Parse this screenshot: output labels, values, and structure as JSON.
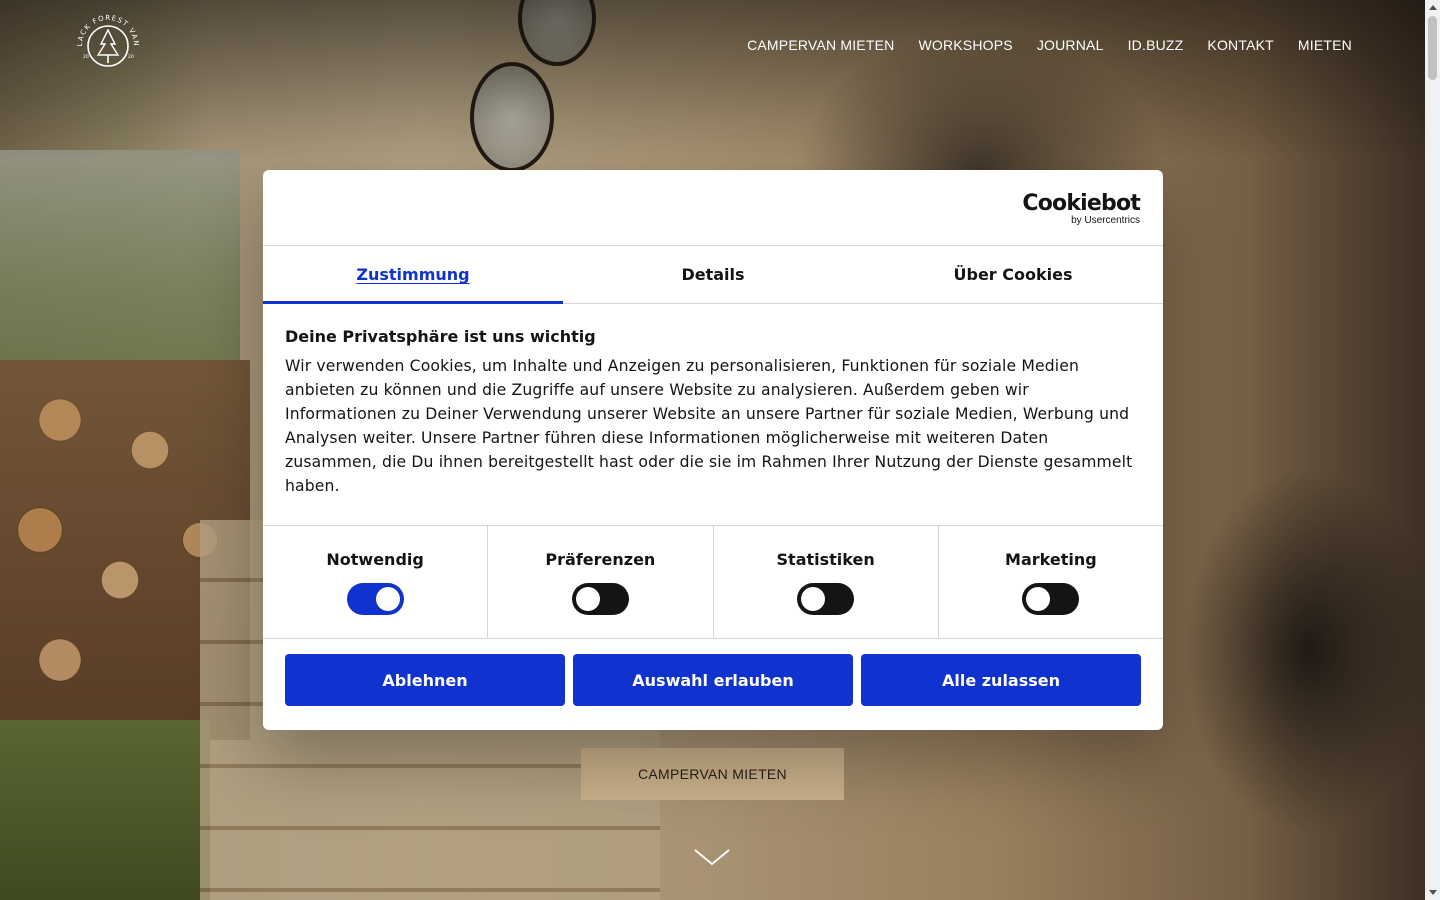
{
  "site": {
    "logo_text": "BLACK FOREST VANS",
    "logo_year_left": "20",
    "logo_year_right": "20"
  },
  "nav": {
    "items": [
      {
        "label": "CAMPERVAN MIETEN"
      },
      {
        "label": "WORKSHOPS"
      },
      {
        "label": "JOURNAL"
      },
      {
        "label": "ID.BUZZ"
      },
      {
        "label": "KONTAKT"
      },
      {
        "label": "MIETEN"
      }
    ]
  },
  "hero": {
    "cta_label": "CAMPERVAN MIETEN",
    "scroll_icon": "chevron-down-icon"
  },
  "cookie_dialog": {
    "brand_name": "Cookiebot",
    "brand_by": "by Usercentrics",
    "tabs": [
      {
        "label": "Zustimmung",
        "active": true
      },
      {
        "label": "Details",
        "active": false
      },
      {
        "label": "Über Cookies",
        "active": false
      }
    ],
    "heading": "Deine Privatsphäre ist uns wichtig",
    "text": "Wir verwenden Cookies, um Inhalte und Anzeigen zu personalisieren, Funktionen für soziale Medien anbieten zu können und die Zugriffe auf unsere Website zu analysieren. Außerdem geben wir Informationen zu Deiner Verwendung unserer Website an unsere Partner für soziale Medien, Werbung und Analysen weiter. Unsere Partner führen diese Informationen möglicherweise mit weiteren Daten zusammen, die Du ihnen bereitgestellt hast oder die sie im Rahmen Ihrer Nutzung der Dienste gesammelt haben.",
    "toggles": [
      {
        "label": "Notwendig",
        "on": true
      },
      {
        "label": "Präferenzen",
        "on": false
      },
      {
        "label": "Statistiken",
        "on": false
      },
      {
        "label": "Marketing",
        "on": false
      }
    ],
    "buttons": {
      "decline": "Ablehnen",
      "allow_selection": "Auswahl erlauben",
      "allow_all": "Alle zulassen"
    }
  },
  "colors": {
    "accent_blue": "#1032cf",
    "cta_beige": "#c9b08a",
    "toggle_off": "#141414"
  }
}
